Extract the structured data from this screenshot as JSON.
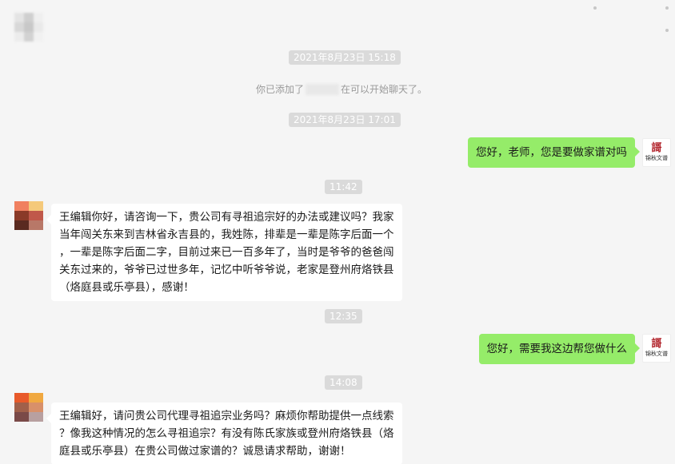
{
  "chat": {
    "time_1": "2021年8月23日 15:18",
    "system_note_before": "你已添加了",
    "system_note_after": "在可以开始聊天了。",
    "time_2": "2021年8月23日 17:01",
    "msg_1": "您好，老师，您是要做家谱对吗",
    "time_3": "11:42",
    "msg_2_lines": [
      "王编辑你好，请咨询一下，贵公司有寻祖追宗好的办法或建议吗？我家",
      "当年闯关东来到吉林省永吉县的，我姓陈，排辈是一辈是陈字后面一个",
      "，一辈是陈字后面二字，目前过来已一百多年了，当时是爷爷的爸爸闯",
      "关东过来的，爷爷已过世多年，记忆中听爷爷说，老家是登州府烙铁县",
      "（烙庭县或乐亭县），感谢！"
    ],
    "time_4": "12:35",
    "msg_3": "您好，需要我这边帮您做什么",
    "time_5": "14:08",
    "msg_4_lines": [
      "王编辑好，请问贵公司代理寻祖追宗业务吗？麻烦你帮助提供一点线索",
      "？像我这种情况的怎么寻祖追宗？有没有陈氏家族或登州府烙铁县（烙",
      "庭县或乐亭县）在贵公司做过家谱的？诚恳请求帮助，谢谢！"
    ]
  },
  "self_avatar": {
    "mark": "謌",
    "text": "锦秋文谱"
  },
  "colors": {
    "background": "#f5f5f5",
    "outgoing_bubble": "#95ec69",
    "incoming_bubble": "#ffffff",
    "timestamp_bg": "#dadada",
    "peer_avatar_tiles": [
      "#f08060",
      "#f5c97a",
      "#8a3a28",
      "#c0584a",
      "#5a2a20",
      "#b87868"
    ],
    "peer_avatar_tiles_2": [
      "#e85a2a",
      "#f0a840",
      "#a0604a",
      "#d8906a",
      "#7a4a48",
      "#b8a0a0"
    ]
  },
  "icons": [
    "blurred-contact-avatar",
    "window-dots",
    "jinqiu-logo-avatar",
    "mosaic-peer-avatar"
  ]
}
